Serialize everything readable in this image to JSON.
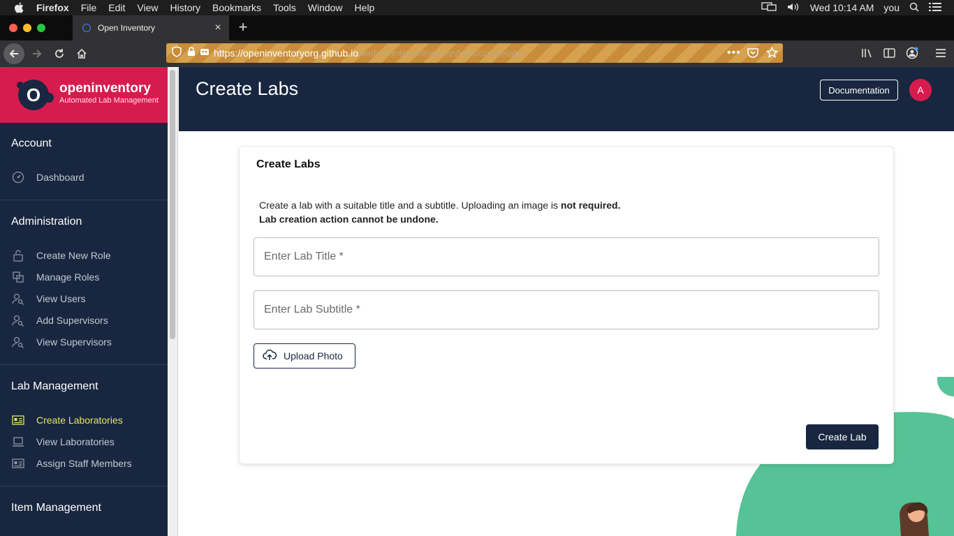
{
  "menubar": {
    "app": "Firefox",
    "items": [
      "File",
      "Edit",
      "View",
      "History",
      "Bookmarks",
      "Tools",
      "Window",
      "Help"
    ],
    "clock": "Wed 10:14 AM",
    "user": "you"
  },
  "browser": {
    "tab_title": "Open Inventory",
    "url_domain": "https://openinventoryorg.github.io",
    "url_path": "/web-frontend/#/admin/labs/createlabs"
  },
  "brand": {
    "name": "openinventory",
    "tagline": "Automated Lab Management",
    "logo_letter": "O"
  },
  "sidebar": {
    "sections": [
      {
        "title": "Account",
        "items": [
          {
            "label": "Dashboard",
            "icon": "gauge-icon"
          }
        ]
      },
      {
        "title": "Administration",
        "items": [
          {
            "label": "Create New Role",
            "icon": "lock-icon"
          },
          {
            "label": "Manage Roles",
            "icon": "roles-icon"
          },
          {
            "label": "View Users",
            "icon": "user-search-icon"
          },
          {
            "label": "Add Supervisors",
            "icon": "user-search-icon"
          },
          {
            "label": "View Supervisors",
            "icon": "user-search-icon"
          }
        ]
      },
      {
        "title": "Lab Management",
        "items": [
          {
            "label": "Create Laboratories",
            "icon": "id-card-icon",
            "active": true
          },
          {
            "label": "View Laboratories",
            "icon": "laptop-icon"
          },
          {
            "label": "Assign Staff Members",
            "icon": "id-card-icon"
          }
        ]
      },
      {
        "title": "Item Management",
        "items": []
      }
    ]
  },
  "header": {
    "title": "Create Labs",
    "doc_button": "Documentation",
    "avatar_letter": "A"
  },
  "card": {
    "title": "Create Labs",
    "desc_text": "Create a lab with a suitable title and a subtitle. Uploading an image is ",
    "desc_bold": "not required.",
    "desc_line2": "Lab creation action cannot be undone.",
    "title_placeholder": "Enter Lab Title *",
    "subtitle_placeholder": "Enter Lab Subtitle *",
    "upload_label": "Upload Photo",
    "submit_label": "Create Lab"
  },
  "colors": {
    "navy": "#18273f",
    "brand_red": "#d81b4e",
    "active_nav": "#e4e56a",
    "deco_green": "#4fc08d"
  }
}
